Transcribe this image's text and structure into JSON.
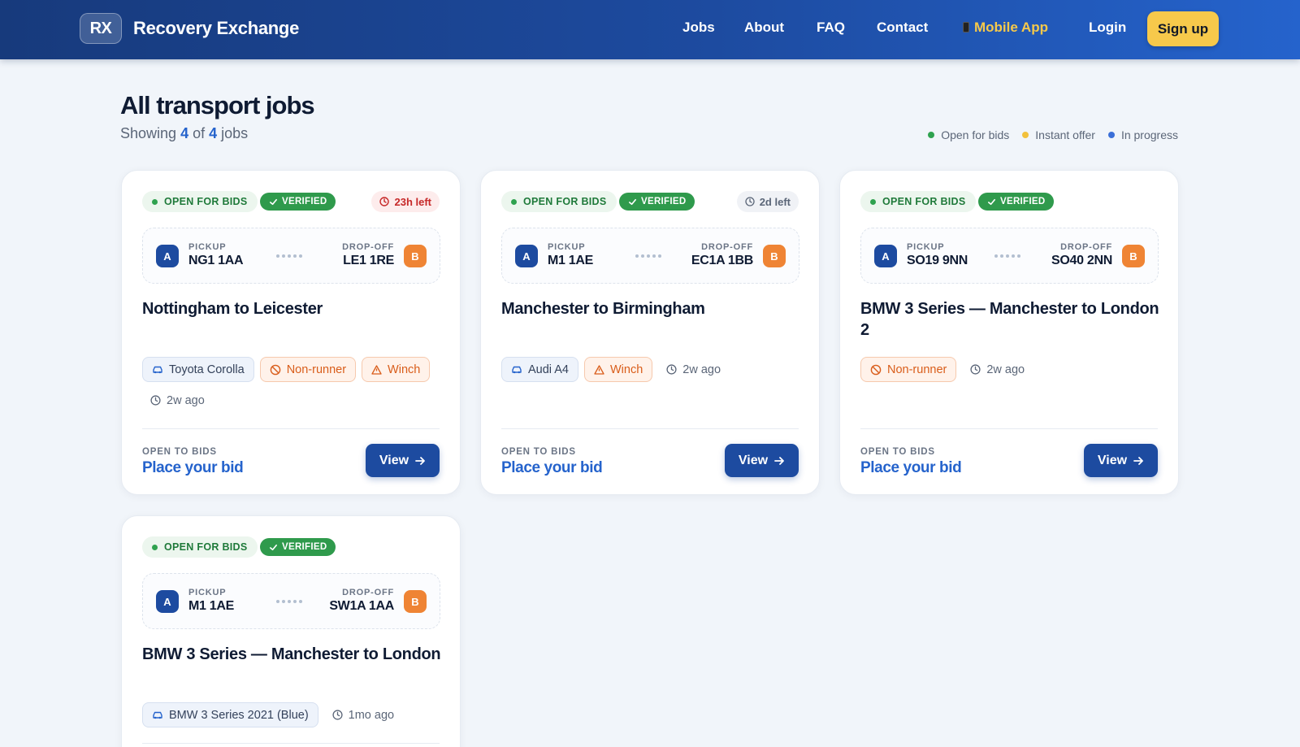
{
  "nav": {
    "badge": "RX",
    "brand": "Recovery Exchange",
    "links": [
      "Jobs",
      "About",
      "FAQ",
      "Contact"
    ],
    "mobile": "Mobile App",
    "login": "Login",
    "signup": "Sign up"
  },
  "header": {
    "title": "All transport jobs",
    "showing_prefix": "Showing",
    "count": "4",
    "of": "of",
    "total": "4",
    "suffix": "jobs"
  },
  "legend": [
    {
      "label": "Open for bids",
      "color": "#2fa24f"
    },
    {
      "label": "Instant offer",
      "color": "#f2c13c"
    },
    {
      "label": "In progress",
      "color": "#3b6fd8"
    }
  ],
  "labels": {
    "open_for_bids": "OPEN FOR BIDS",
    "verified": "VERIFIED",
    "pickup": "PICKUP",
    "dropoff": "DROP-OFF",
    "pickup_marker": "A",
    "dropoff_marker": "B",
    "open_to_bids": "OPEN TO BIDS",
    "place_bid": "Place your bid",
    "view": "View"
  },
  "jobs": [
    {
      "time_left": "23h left",
      "pickup": "NG1 1AA",
      "dropoff": "LE1 1RE",
      "title": "Nottingham to Leicester",
      "vehicle": "Toyota Corolla",
      "tags": [
        "Non-runner",
        "Winch"
      ],
      "age": "2w ago"
    },
    {
      "time_left": "2d left",
      "pickup": "M1 1AE",
      "dropoff": "EC1A 1BB",
      "title": "Manchester to Birmingham",
      "vehicle": "Audi A4",
      "tags": [
        "Winch"
      ],
      "age": "2w ago"
    },
    {
      "pickup": "SO19 9NN",
      "dropoff": "SO40 2NN",
      "title": "BMW 3 Series — Manchester to London 2",
      "tags": [
        "Non-runner"
      ],
      "age": "2w ago"
    },
    {
      "pickup": "M1 1AE",
      "dropoff": "SW1A 1AA",
      "title": "BMW 3 Series — Manchester to London",
      "vehicle": "BMW 3 Series 2021 (Blue)",
      "age": "1mo ago"
    }
  ]
}
